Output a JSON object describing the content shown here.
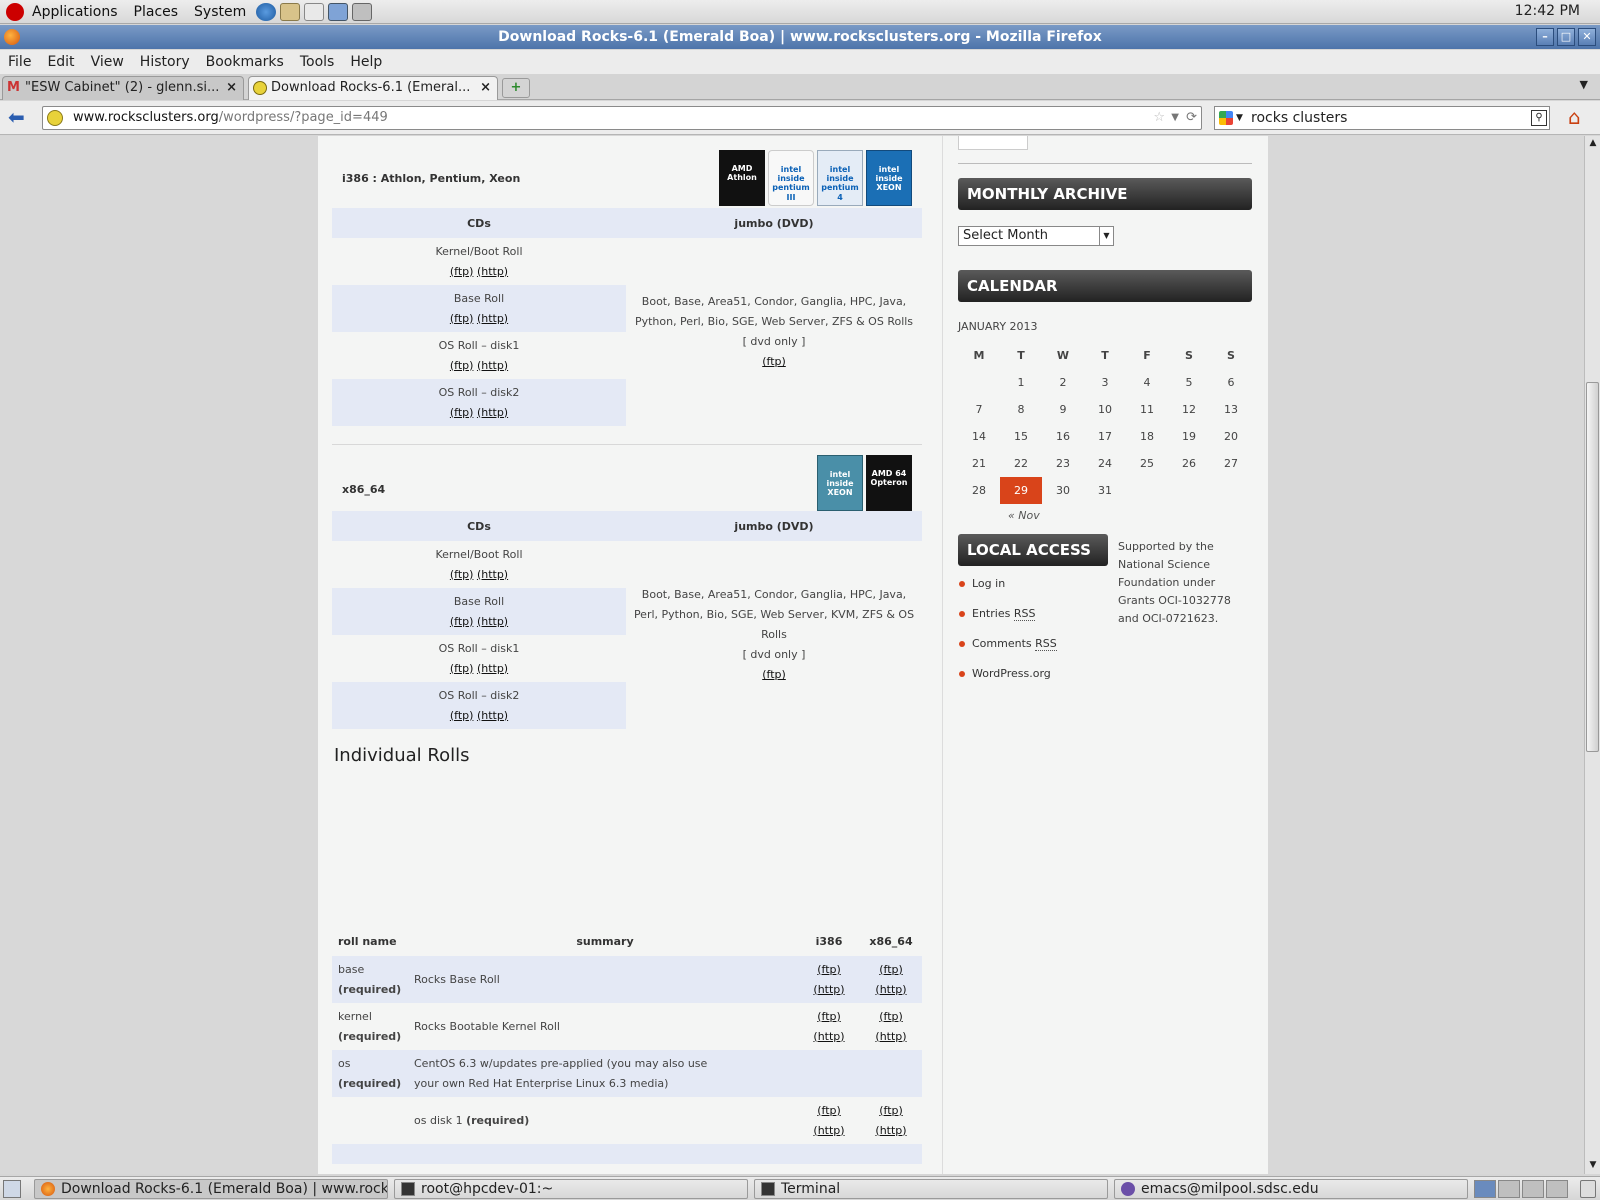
{
  "panel": {
    "menus": [
      "Applications",
      "Places",
      "System"
    ],
    "clock": "12:42 PM"
  },
  "window": {
    "title": "Download Rocks-6.1 (Emerald Boa) | www.rocksclusters.org - Mozilla Firefox",
    "buttons": [
      "–",
      "□",
      "✕"
    ]
  },
  "menubar": [
    "File",
    "Edit",
    "View",
    "History",
    "Bookmarks",
    "Tools",
    "Help"
  ],
  "tabs": [
    {
      "label": "\"ESW Cabinet\" (2) - glenn.si...",
      "close": "×"
    },
    {
      "label": "Download Rocks-6.1 (Emeral...",
      "close": "×"
    }
  ],
  "newtab_icon": "+",
  "nav": {
    "url_domain": "www.rocksclusters.org",
    "url_path": "/wordpress/?page_id=449",
    "search_value": "rocks clusters"
  },
  "i386": {
    "label": "i386 : Athlon, Pentium, Xeon",
    "logos": [
      "AMD Athlon",
      "intel inside pentium III",
      "intel inside pentium 4",
      "intel inside XEON"
    ],
    "headers": [
      "CDs",
      "jumbo (DVD)"
    ],
    "rows": [
      {
        "name": "Kernel/Boot Roll",
        "ftp": "(ftp)",
        "http": "(http)"
      },
      {
        "name": "Base Roll",
        "ftp": "(ftp)",
        "http": "(http)"
      },
      {
        "name": "OS Roll – disk1",
        "ftp": "(ftp)",
        "http": "(http)"
      },
      {
        "name": "OS Roll – disk2",
        "ftp": "(ftp)",
        "http": "(http)"
      }
    ],
    "jumbo_text": "Boot, Base, Area51, Condor, Ganglia, HPC, Java, Python, Perl, Bio, SGE, Web Server, ZFS & OS Rolls",
    "jumbo_note": "[ dvd only ]",
    "jumbo_link": "(ftp)"
  },
  "x86_64": {
    "label": "x86_64",
    "logos": [
      "intel inside XEON",
      "AMD 64 Opteron"
    ],
    "headers": [
      "CDs",
      "jumbo (DVD)"
    ],
    "rows": [
      {
        "name": "Kernel/Boot Roll",
        "ftp": "(ftp)",
        "http": "(http)"
      },
      {
        "name": "Base Roll",
        "ftp": "(ftp)",
        "http": "(http)"
      },
      {
        "name": "OS Roll – disk1",
        "ftp": "(ftp)",
        "http": "(http)"
      },
      {
        "name": "OS Roll – disk2",
        "ftp": "(ftp)",
        "http": "(http)"
      }
    ],
    "jumbo_text": "Boot, Base, Area51, Condor, Ganglia, HPC, Java, Perl, Python, Bio, SGE, Web Server, KVM, ZFS & OS Rolls",
    "jumbo_note": "[ dvd only ]",
    "jumbo_link": "(ftp)"
  },
  "individual": {
    "title": "Individual Rolls",
    "headers": [
      "roll name",
      "summary",
      "i386",
      "x86_64"
    ],
    "rows": [
      {
        "name": "base",
        "req": "(required)",
        "summary": "Rocks Base Roll",
        "i386_ftp": "(ftp)",
        "i386_http": "(http)",
        "x64_ftp": "(ftp)",
        "x64_http": "(http)"
      },
      {
        "name": "kernel",
        "req": "(required)",
        "summary": "Rocks Bootable Kernel Roll",
        "i386_ftp": "(ftp)",
        "i386_http": "(http)",
        "x64_ftp": "(ftp)",
        "x64_http": "(http)"
      },
      {
        "name": "os",
        "req": "(required)",
        "summary": "CentOS 6.3 w/updates pre-applied (you may also use your own Red Hat Enterprise Linux 6.3 media)"
      },
      {
        "name": "",
        "summary": "os disk 1",
        "summary_req": "(required)",
        "i386_ftp": "(ftp)",
        "i386_http": "(http)",
        "x64_ftp": "(ftp)",
        "x64_http": "(http)"
      }
    ]
  },
  "sidebar": {
    "archive_title": "MONTHLY ARCHIVE",
    "archive_select": "Select Month",
    "calendar_title": "CALENDAR",
    "calendar_caption": "JANUARY 2013",
    "weekdays": [
      "M",
      "T",
      "W",
      "T",
      "F",
      "S",
      "S"
    ],
    "weeks": [
      [
        "",
        "1",
        "2",
        "3",
        "4",
        "5",
        "6"
      ],
      [
        "7",
        "8",
        "9",
        "10",
        "11",
        "12",
        "13"
      ],
      [
        "14",
        "15",
        "16",
        "17",
        "18",
        "19",
        "20"
      ],
      [
        "21",
        "22",
        "23",
        "24",
        "25",
        "26",
        "27"
      ],
      [
        "28",
        "29",
        "30",
        "31",
        "",
        "",
        ""
      ]
    ],
    "today": "29",
    "prev_month": "« Nov",
    "local_title": "LOCAL ACCESS",
    "local_links": [
      {
        "text": "Log in",
        "abbr": ""
      },
      {
        "text": "Entries ",
        "abbr": "RSS"
      },
      {
        "text": "Comments ",
        "abbr": "RSS"
      },
      {
        "text": "WordPress.org",
        "abbr": ""
      }
    ],
    "nsf_note": "Supported by the National Science Foundation under Grants OCI-1032778 and OCI-0721623."
  },
  "taskbar": [
    {
      "label": "Download Rocks-6.1 (Emerald Boa) | www.rock...",
      "icon": "firefox-icon",
      "active": true
    },
    {
      "label": "root@hpcdev-01:~",
      "icon": "terminal-icon",
      "active": false
    },
    {
      "label": "Terminal",
      "icon": "terminal-icon",
      "active": false
    },
    {
      "label": "emacs@milpool.sdsc.edu",
      "icon": "emacs-icon",
      "active": false
    }
  ],
  "colors": {
    "title_bar": "#4d74aa",
    "row_tint": "#e4e9f5",
    "today": "#d9441a",
    "widget_header": "#222222"
  }
}
